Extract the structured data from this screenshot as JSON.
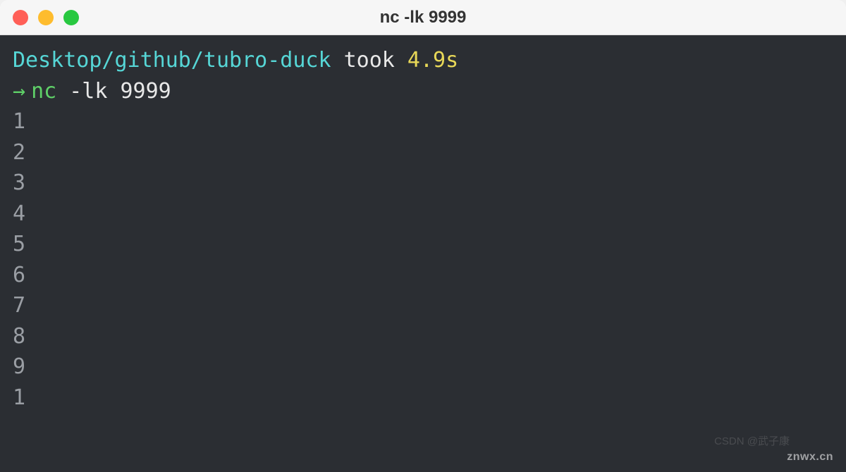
{
  "window": {
    "title": "nc -lk 9999"
  },
  "prompt": {
    "path": "Desktop/github/tubro-duck",
    "took_word": "took",
    "duration": "4.9s",
    "arrow": "→",
    "command": "nc",
    "args": "-lk 9999"
  },
  "output": [
    "1",
    "2",
    "3",
    "4",
    "5",
    "6",
    "7",
    "8",
    "9",
    "1"
  ],
  "watermark": "znwx.cn",
  "watermark2": "CSDN @武子康"
}
